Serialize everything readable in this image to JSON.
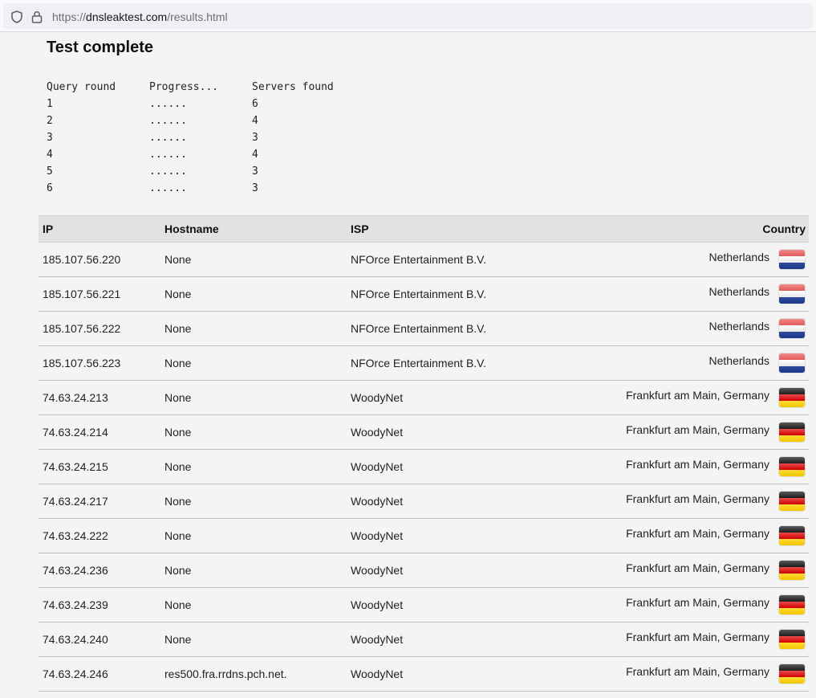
{
  "browser": {
    "url_prefix": "https://",
    "url_domain": "dnsleaktest.com",
    "url_path": "/results.html",
    "icons": [
      "shield-icon",
      "lock-icon"
    ]
  },
  "page": {
    "title": "Test complete"
  },
  "progress": {
    "headers": [
      "Query round",
      "Progress...",
      "Servers found"
    ],
    "rows": [
      {
        "round": "1",
        "progress": "......",
        "found": "6"
      },
      {
        "round": "2",
        "progress": "......",
        "found": "4"
      },
      {
        "round": "3",
        "progress": "......",
        "found": "3"
      },
      {
        "round": "4",
        "progress": "......",
        "found": "4"
      },
      {
        "round": "5",
        "progress": "......",
        "found": "3"
      },
      {
        "round": "6",
        "progress": "......",
        "found": "3"
      }
    ]
  },
  "results": {
    "headers": {
      "ip": "IP",
      "hostname": "Hostname",
      "isp": "ISP",
      "country": "Country"
    },
    "rows": [
      {
        "ip": "185.107.56.220",
        "hostname": "None",
        "isp": "NFOrce Entertainment B.V.",
        "country": "Netherlands",
        "flag": "nl"
      },
      {
        "ip": "185.107.56.221",
        "hostname": "None",
        "isp": "NFOrce Entertainment B.V.",
        "country": "Netherlands",
        "flag": "nl"
      },
      {
        "ip": "185.107.56.222",
        "hostname": "None",
        "isp": "NFOrce Entertainment B.V.",
        "country": "Netherlands",
        "flag": "nl"
      },
      {
        "ip": "185.107.56.223",
        "hostname": "None",
        "isp": "NFOrce Entertainment B.V.",
        "country": "Netherlands",
        "flag": "nl"
      },
      {
        "ip": "74.63.24.213",
        "hostname": "None",
        "isp": "WoodyNet",
        "country": "Frankfurt am Main, Germany",
        "flag": "de"
      },
      {
        "ip": "74.63.24.214",
        "hostname": "None",
        "isp": "WoodyNet",
        "country": "Frankfurt am Main, Germany",
        "flag": "de"
      },
      {
        "ip": "74.63.24.215",
        "hostname": "None",
        "isp": "WoodyNet",
        "country": "Frankfurt am Main, Germany",
        "flag": "de"
      },
      {
        "ip": "74.63.24.217",
        "hostname": "None",
        "isp": "WoodyNet",
        "country": "Frankfurt am Main, Germany",
        "flag": "de"
      },
      {
        "ip": "74.63.24.222",
        "hostname": "None",
        "isp": "WoodyNet",
        "country": "Frankfurt am Main, Germany",
        "flag": "de"
      },
      {
        "ip": "74.63.24.236",
        "hostname": "None",
        "isp": "WoodyNet",
        "country": "Frankfurt am Main, Germany",
        "flag": "de"
      },
      {
        "ip": "74.63.24.239",
        "hostname": "None",
        "isp": "WoodyNet",
        "country": "Frankfurt am Main, Germany",
        "flag": "de"
      },
      {
        "ip": "74.63.24.240",
        "hostname": "None",
        "isp": "WoodyNet",
        "country": "Frankfurt am Main, Germany",
        "flag": "de"
      },
      {
        "ip": "74.63.24.246",
        "hostname": "res500.fra.rrdns.pch.net.",
        "isp": "WoodyNet",
        "country": "Frankfurt am Main, Germany",
        "flag": "de"
      }
    ]
  }
}
